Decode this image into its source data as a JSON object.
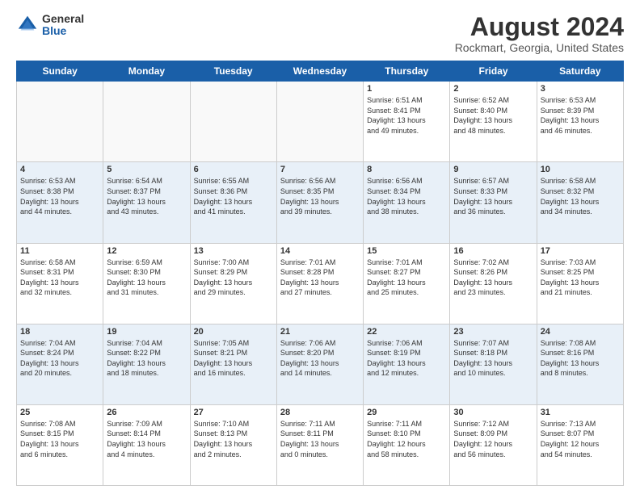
{
  "logo": {
    "general": "General",
    "blue": "Blue"
  },
  "title": "August 2024",
  "subtitle": "Rockmart, Georgia, United States",
  "weekdays": [
    "Sunday",
    "Monday",
    "Tuesday",
    "Wednesday",
    "Thursday",
    "Friday",
    "Saturday"
  ],
  "rows": [
    {
      "bg": "#fff",
      "cells": [
        {
          "day": "",
          "info": "",
          "empty": true
        },
        {
          "day": "",
          "info": "",
          "empty": true
        },
        {
          "day": "",
          "info": "",
          "empty": true
        },
        {
          "day": "",
          "info": "",
          "empty": true
        },
        {
          "day": "1",
          "info": "Sunrise: 6:51 AM\nSunset: 8:41 PM\nDaylight: 13 hours\nand 49 minutes."
        },
        {
          "day": "2",
          "info": "Sunrise: 6:52 AM\nSunset: 8:40 PM\nDaylight: 13 hours\nand 48 minutes."
        },
        {
          "day": "3",
          "info": "Sunrise: 6:53 AM\nSunset: 8:39 PM\nDaylight: 13 hours\nand 46 minutes."
        }
      ]
    },
    {
      "bg": "#e8f0f8",
      "cells": [
        {
          "day": "4",
          "info": "Sunrise: 6:53 AM\nSunset: 8:38 PM\nDaylight: 13 hours\nand 44 minutes."
        },
        {
          "day": "5",
          "info": "Sunrise: 6:54 AM\nSunset: 8:37 PM\nDaylight: 13 hours\nand 43 minutes."
        },
        {
          "day": "6",
          "info": "Sunrise: 6:55 AM\nSunset: 8:36 PM\nDaylight: 13 hours\nand 41 minutes."
        },
        {
          "day": "7",
          "info": "Sunrise: 6:56 AM\nSunset: 8:35 PM\nDaylight: 13 hours\nand 39 minutes."
        },
        {
          "day": "8",
          "info": "Sunrise: 6:56 AM\nSunset: 8:34 PM\nDaylight: 13 hours\nand 38 minutes."
        },
        {
          "day": "9",
          "info": "Sunrise: 6:57 AM\nSunset: 8:33 PM\nDaylight: 13 hours\nand 36 minutes."
        },
        {
          "day": "10",
          "info": "Sunrise: 6:58 AM\nSunset: 8:32 PM\nDaylight: 13 hours\nand 34 minutes."
        }
      ]
    },
    {
      "bg": "#fff",
      "cells": [
        {
          "day": "11",
          "info": "Sunrise: 6:58 AM\nSunset: 8:31 PM\nDaylight: 13 hours\nand 32 minutes."
        },
        {
          "day": "12",
          "info": "Sunrise: 6:59 AM\nSunset: 8:30 PM\nDaylight: 13 hours\nand 31 minutes."
        },
        {
          "day": "13",
          "info": "Sunrise: 7:00 AM\nSunset: 8:29 PM\nDaylight: 13 hours\nand 29 minutes."
        },
        {
          "day": "14",
          "info": "Sunrise: 7:01 AM\nSunset: 8:28 PM\nDaylight: 13 hours\nand 27 minutes."
        },
        {
          "day": "15",
          "info": "Sunrise: 7:01 AM\nSunset: 8:27 PM\nDaylight: 13 hours\nand 25 minutes."
        },
        {
          "day": "16",
          "info": "Sunrise: 7:02 AM\nSunset: 8:26 PM\nDaylight: 13 hours\nand 23 minutes."
        },
        {
          "day": "17",
          "info": "Sunrise: 7:03 AM\nSunset: 8:25 PM\nDaylight: 13 hours\nand 21 minutes."
        }
      ]
    },
    {
      "bg": "#e8f0f8",
      "cells": [
        {
          "day": "18",
          "info": "Sunrise: 7:04 AM\nSunset: 8:24 PM\nDaylight: 13 hours\nand 20 minutes."
        },
        {
          "day": "19",
          "info": "Sunrise: 7:04 AM\nSunset: 8:22 PM\nDaylight: 13 hours\nand 18 minutes."
        },
        {
          "day": "20",
          "info": "Sunrise: 7:05 AM\nSunset: 8:21 PM\nDaylight: 13 hours\nand 16 minutes."
        },
        {
          "day": "21",
          "info": "Sunrise: 7:06 AM\nSunset: 8:20 PM\nDaylight: 13 hours\nand 14 minutes."
        },
        {
          "day": "22",
          "info": "Sunrise: 7:06 AM\nSunset: 8:19 PM\nDaylight: 13 hours\nand 12 minutes."
        },
        {
          "day": "23",
          "info": "Sunrise: 7:07 AM\nSunset: 8:18 PM\nDaylight: 13 hours\nand 10 minutes."
        },
        {
          "day": "24",
          "info": "Sunrise: 7:08 AM\nSunset: 8:16 PM\nDaylight: 13 hours\nand 8 minutes."
        }
      ]
    },
    {
      "bg": "#fff",
      "cells": [
        {
          "day": "25",
          "info": "Sunrise: 7:08 AM\nSunset: 8:15 PM\nDaylight: 13 hours\nand 6 minutes."
        },
        {
          "day": "26",
          "info": "Sunrise: 7:09 AM\nSunset: 8:14 PM\nDaylight: 13 hours\nand 4 minutes."
        },
        {
          "day": "27",
          "info": "Sunrise: 7:10 AM\nSunset: 8:13 PM\nDaylight: 13 hours\nand 2 minutes."
        },
        {
          "day": "28",
          "info": "Sunrise: 7:11 AM\nSunset: 8:11 PM\nDaylight: 13 hours\nand 0 minutes."
        },
        {
          "day": "29",
          "info": "Sunrise: 7:11 AM\nSunset: 8:10 PM\nDaylight: 12 hours\nand 58 minutes."
        },
        {
          "day": "30",
          "info": "Sunrise: 7:12 AM\nSunset: 8:09 PM\nDaylight: 12 hours\nand 56 minutes."
        },
        {
          "day": "31",
          "info": "Sunrise: 7:13 AM\nSunset: 8:07 PM\nDaylight: 12 hours\nand 54 minutes."
        }
      ]
    }
  ]
}
